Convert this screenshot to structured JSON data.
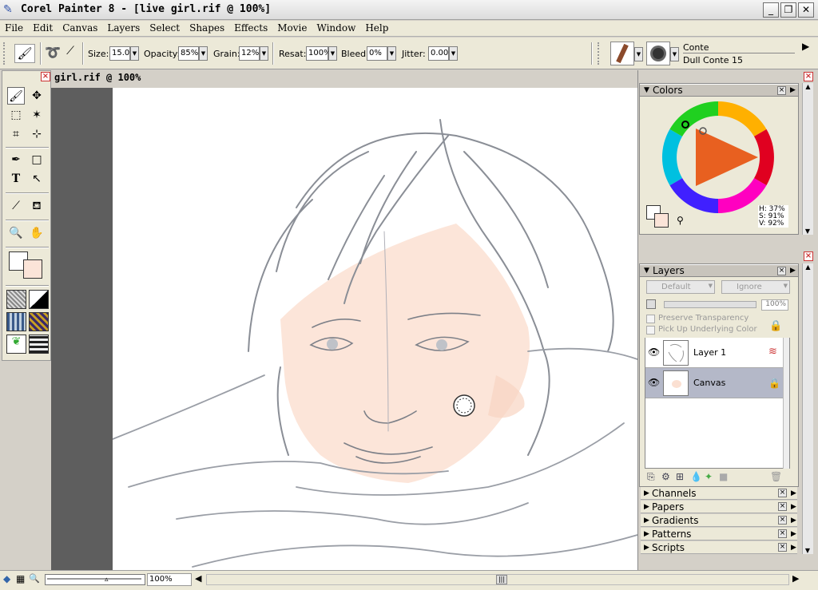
{
  "window": {
    "title": "Corel Painter 8 - [live girl.rif @ 100%]",
    "minimize_glyph": "_",
    "restore_glyph": "❐",
    "close_glyph": "✕"
  },
  "menu": [
    "File",
    "Edit",
    "Canvas",
    "Layers",
    "Select",
    "Shapes",
    "Effects",
    "Movie",
    "Window",
    "Help"
  ],
  "property_bar": {
    "size_label": "Size:",
    "size_value": "15.0",
    "opacity_label": "Opacity:",
    "opacity_value": "85%",
    "grain_label": "Grain:",
    "grain_value": "12%",
    "resat_label": "Resat:",
    "resat_value": "100%",
    "bleed_label": "Bleed:",
    "bleed_value": "0%",
    "jitter_label": "Jitter:",
    "jitter_value": "0.00",
    "brush_category": "Conte",
    "brush_variant": "Dull Conte 15"
  },
  "document": {
    "title": "girl.rif @ 100%",
    "zoom": "100%"
  },
  "colors_panel": {
    "title": "Colors",
    "h": "H: 37%",
    "s": "S: 91%",
    "v": "V: 92%",
    "primary_color": "#ffffff",
    "secondary_color": "#fbe4d8"
  },
  "layers_panel": {
    "title": "Layers",
    "composite_method": "Default",
    "composite_depth": "Ignore",
    "opacity": "100%",
    "preserve_transparency": "Preserve Transparency",
    "pick_up_underlying": "Pick Up Underlying Color",
    "layers": [
      {
        "name": "Layer 1",
        "selected": false
      },
      {
        "name": "Canvas",
        "selected": true
      }
    ]
  },
  "collapsed_panels": [
    "Channels",
    "Papers",
    "Gradients",
    "Patterns",
    "Scripts"
  ],
  "colors": {
    "skin": "#fbe0d2",
    "sketch_line": "#8a8e96",
    "selected_layer": "#b4b8c8",
    "canvas_gray": "#5e5e5e"
  }
}
